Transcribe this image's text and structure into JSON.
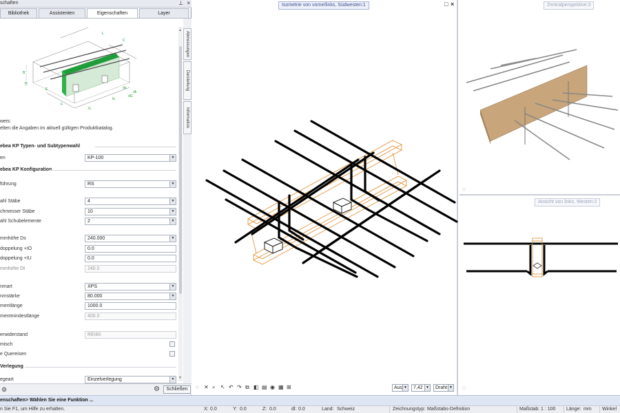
{
  "panel": {
    "title": "schaften",
    "tabs": [
      "Bibliothek",
      "Assistenten",
      "Eigenschaften",
      "Layer"
    ],
    "active_tab": "Eigenschaften",
    "side_tabs": [
      "Abmessungen",
      "Darstellung",
      "Information"
    ],
    "hint_title": "weis:",
    "hint_text": "elten die Angaben im aktuell gültigen Produktkatalog.",
    "preview_labels": [
      "A",
      "B",
      "C",
      "dk",
      "dG",
      "E",
      "F",
      "G",
      "H",
      "L",
      "lü",
      "ds"
    ],
    "section1": "ebea KP Typen- und Subtypenwahl",
    "row_type_label": "en",
    "row_type_value": "KP-100",
    "section2": "ebea KP Konfiguration",
    "rows": {
      "ausfuehrung": {
        "label": "führung",
        "value": "RS"
      },
      "anzahl_staebe": {
        "label": "ahl Stäbe",
        "value": "4"
      },
      "durchmesser": {
        "label": "chmesser Stäbe",
        "value": "10"
      },
      "schubelemente": {
        "label": "ahl Schubelemente",
        "value": "2"
      },
      "dammhoehe_ds": {
        "label": "mmhöhe Ds",
        "value": "240.000"
      },
      "doppelung_io": {
        "label": "doppelung +IO",
        "value": "0.0"
      },
      "doppelung_iu": {
        "label": "doppelung +IU",
        "value": "0.0"
      },
      "dammhoehe_dt": {
        "label": "mmhöhe Dt",
        "value": "240.0"
      },
      "dammart": {
        "label": "nmart",
        "value": "XPS"
      },
      "dammstaerke": {
        "label": "nmstärke",
        "value": "80.000"
      },
      "elementlaenge": {
        "label": "mentlänge",
        "value": "1000.0"
      },
      "mindestlaenge": {
        "label": "mentmindestlänge",
        "value": "400.0"
      },
      "feuerwiderstand": {
        "label": "erwiderstand",
        "value": "REI60"
      },
      "dammisch": {
        "label": "misch"
      },
      "quereisen": {
        "label": "e Quereisen"
      }
    },
    "section3": "Verlegung",
    "row_verlegeart_label": "egeart",
    "row_verlegeart_value": "Einzelverlegung",
    "close_label": "Schließen"
  },
  "viewports": {
    "main_title": "Isometrie von vorne/links, Südwesten:1",
    "persp_title": "Zentralperspektive:3",
    "side_title": "Ansicht von links, Westen:2",
    "main_mode1": "Aus",
    "main_scale": "7,42",
    "main_mode2": "Draht"
  },
  "command": {
    "text": "enschaften> Wählen Sie eine Funktion ..."
  },
  "status": {
    "help": "n Sie F1, um Hilfe zu erhalten.",
    "x_label": "X:",
    "x_value": "0.0",
    "y_label": "Y:",
    "y_value": "0.0",
    "z_label": "Z:",
    "z_value": "0.0",
    "dl_label": "dl:",
    "dl_value": "0.0",
    "land_label": "Land:",
    "land_value": "Schweiz",
    "ztyp_label": "Zeichnungstyp:",
    "ztyp_value": "Maßstabs-Definition",
    "mst_label": "Maßstab:",
    "mst_value": "1 : 100",
    "laenge_label": "Länge:",
    "laenge_value": "mm",
    "winkel_label": "Winkel"
  },
  "colors": {
    "accent_green": "#1f9d3a",
    "insulation_orange": "#e08a2a",
    "wall_beige": "#c8a57a"
  }
}
